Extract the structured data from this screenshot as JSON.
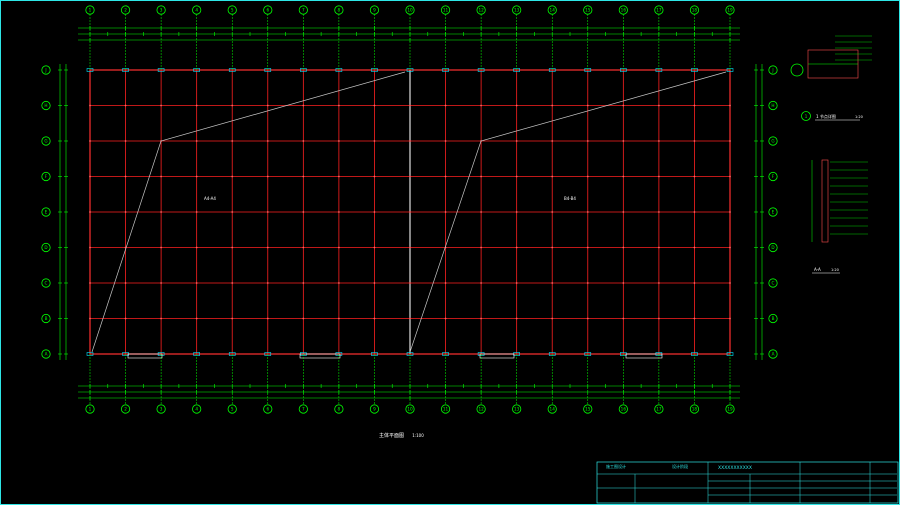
{
  "colors": {
    "background": "#000000",
    "frame": "#2ee6e6",
    "grid_axis": "#00ff00",
    "beam": "#ff2020",
    "wall": "#ff4d4d",
    "brace": "#c8c8c8",
    "dimension": "#00ff00",
    "dim_text": "#ffffff",
    "note": "#00e5e5",
    "title_block": "#2ee6e6"
  },
  "plan": {
    "column_axes": [
      "1",
      "2",
      "3",
      "4",
      "5",
      "6",
      "7",
      "8",
      "9",
      "10",
      "11",
      "12",
      "13",
      "14",
      "15",
      "16",
      "17",
      "18",
      "19"
    ],
    "row_axes": [
      "A",
      "B",
      "C",
      "D",
      "E",
      "F",
      "G",
      "H",
      "J"
    ],
    "title": "主体平面图",
    "scale": "1:100",
    "zone_left_label": "A4-A4",
    "zone_right_label": "B4-B4"
  },
  "details": {
    "circle_marker": "1",
    "detail1_label": "1  节点详图",
    "detail1_scale": "1:20",
    "section_label": "A-A",
    "section_scale": "1:20"
  },
  "title_block": {
    "project": "XXXXXXXXXXX",
    "stage1": "施工图设计",
    "stage2": "设计阶段"
  }
}
